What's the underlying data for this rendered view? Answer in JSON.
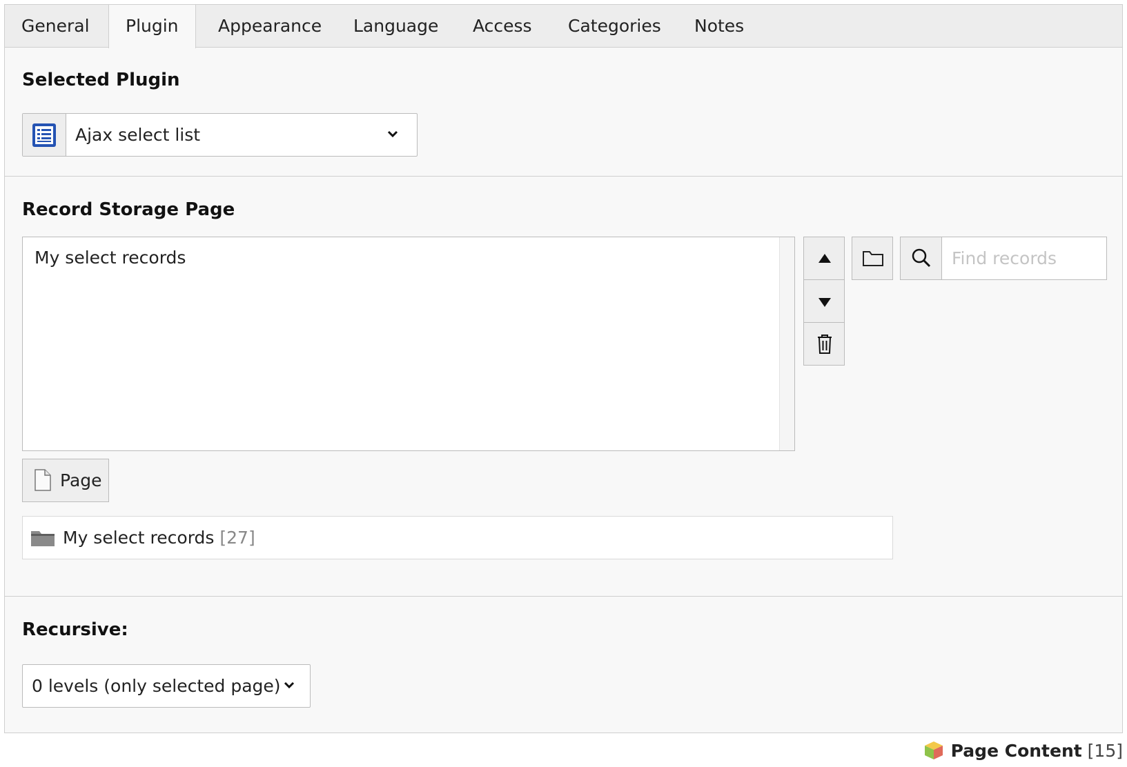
{
  "tabs": [
    {
      "label": "General",
      "active": false
    },
    {
      "label": "Plugin",
      "active": true
    },
    {
      "label": "Appearance",
      "active": false
    },
    {
      "label": "Language",
      "active": false
    },
    {
      "label": "Access",
      "active": false
    },
    {
      "label": "Categories",
      "active": false
    },
    {
      "label": "Notes",
      "active": false
    }
  ],
  "plugin": {
    "label": "Selected Plugin",
    "selected": "Ajax select list",
    "icon": "plugin-list-icon"
  },
  "storage": {
    "label": "Record Storage Page",
    "records": [
      "My select records"
    ],
    "search_placeholder": "Find records",
    "page_button_label": "Page",
    "selected_record": {
      "name": "My select records",
      "uid": "[27]"
    }
  },
  "recursive": {
    "label": "Recursive:",
    "selected": "0 levels (only selected page)"
  },
  "footer": {
    "title": "Page Content",
    "uid": "[15]"
  },
  "colors": {
    "panel_bg": "#f8f8f8",
    "tabbar_bg": "#ededed",
    "plugin_icon_blue": "#2453b3"
  }
}
